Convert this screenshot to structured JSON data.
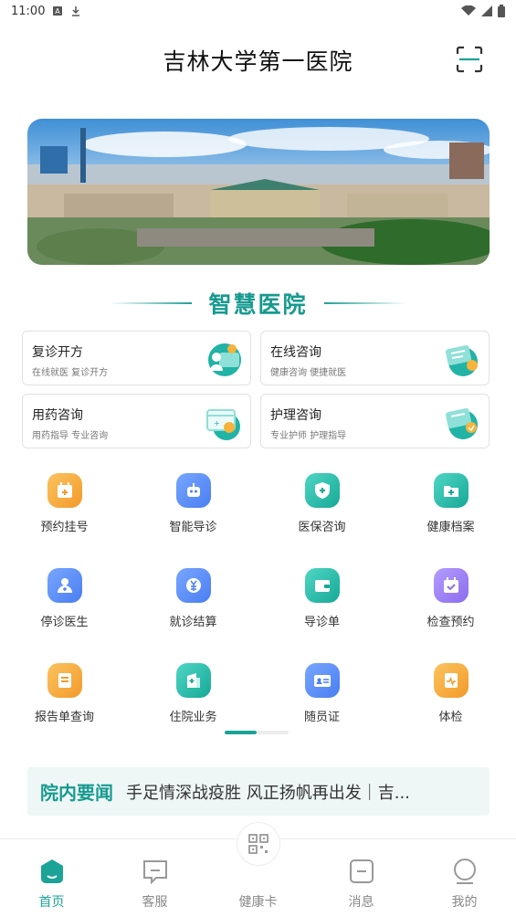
{
  "status_bar": {
    "time": "11:00"
  },
  "header": {
    "title": "吉林大学第一医院"
  },
  "section": {
    "title": "智慧医院"
  },
  "cards": [
    {
      "title": "复诊开方",
      "subtitle": "在线就医 复诊开方",
      "icon": "prescription-icon"
    },
    {
      "title": "在线咨询",
      "subtitle": "健康咨询 便捷就医",
      "icon": "online-consult-icon"
    },
    {
      "title": "用药咨询",
      "subtitle": "用药指导 专业咨询",
      "icon": "medicine-consult-icon"
    },
    {
      "title": "护理咨询",
      "subtitle": "专业护师 护理指导",
      "icon": "nursing-consult-icon"
    }
  ],
  "grid": [
    {
      "label": "预约挂号",
      "icon": "calendar-plus-icon",
      "color": "#f7a43a"
    },
    {
      "label": "智能导诊",
      "icon": "robot-icon",
      "color": "#4f86f7"
    },
    {
      "label": "医保咨询",
      "icon": "shield-plus-icon",
      "color": "#1fb8a7"
    },
    {
      "label": "健康档案",
      "icon": "folder-plus-icon",
      "color": "#1fb8a7"
    },
    {
      "label": "停诊医生",
      "icon": "doctor-icon",
      "color": "#4f86f7"
    },
    {
      "label": "就诊结算",
      "icon": "yuan-icon",
      "color": "#4f86f7"
    },
    {
      "label": "导诊单",
      "icon": "wallet-icon",
      "color": "#1fb8a7"
    },
    {
      "label": "检查预约",
      "icon": "calendar-check-icon",
      "color": "#9a7cf0"
    },
    {
      "label": "报告单查询",
      "icon": "report-icon",
      "color": "#f7a43a"
    },
    {
      "label": "住院业务",
      "icon": "hospital-icon",
      "color": "#1fb8a7"
    },
    {
      "label": "随员证",
      "icon": "id-card-icon",
      "color": "#4f86f7"
    },
    {
      "label": "体检",
      "icon": "health-check-icon",
      "color": "#f7a43a"
    }
  ],
  "news": {
    "tag": "院内要闻",
    "headline": "手足情深战疫胜 风正扬帆再出发｜吉..."
  },
  "tabs": [
    {
      "label": "首页",
      "icon": "home-icon",
      "active": true
    },
    {
      "label": "客服",
      "icon": "chat-icon",
      "active": false
    },
    {
      "label": "健康卡",
      "icon": "qr-code-icon",
      "active": false
    },
    {
      "label": "消息",
      "icon": "message-icon",
      "active": false
    },
    {
      "label": "我的",
      "icon": "profile-icon",
      "active": false
    }
  ],
  "colors": {
    "accent": "#1aa396",
    "news_bg": "#eef7f6"
  }
}
